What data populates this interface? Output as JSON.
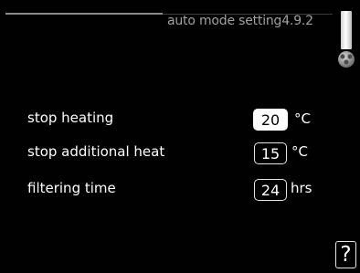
{
  "header": {
    "title": "auto mode setting",
    "menu_number": "4.9.2"
  },
  "settings": [
    {
      "label": "stop heating",
      "value": "20",
      "unit": "°C",
      "selected": true
    },
    {
      "label": "stop additional heat",
      "value": "15",
      "unit": "°C",
      "selected": false
    },
    {
      "label": "filtering time",
      "value": "24",
      "unit": "hrs",
      "selected": false
    }
  ],
  "help": {
    "label": "?"
  },
  "icons": {
    "scroll_knob": "scroll-knob-icon"
  },
  "colors": {
    "background": "#000000",
    "text": "#ffffff",
    "header_text": "#a0a0a0"
  }
}
